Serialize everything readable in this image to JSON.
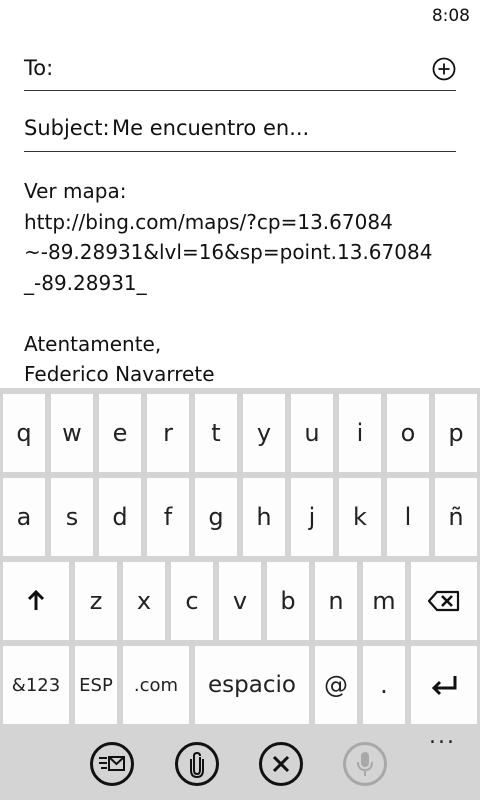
{
  "status": {
    "time": "8:08"
  },
  "compose": {
    "to_label": "To:",
    "subject_label": "Subject:",
    "subject_value": "Me encuentro en...",
    "body_lines": [
      "Ver mapa:",
      "http://bing.com/maps/?cp=13.67084",
      "~-89.28931&lvl=16&sp=point.13.67084",
      "_-89.28931_",
      "",
      "Atentamente,",
      "Federico Navarrete"
    ]
  },
  "keyboard": {
    "row1": [
      "q",
      "w",
      "e",
      "r",
      "t",
      "y",
      "u",
      "i",
      "o",
      "p"
    ],
    "row2": [
      "a",
      "s",
      "d",
      "f",
      "g",
      "h",
      "j",
      "k",
      "l",
      "ñ"
    ],
    "row3": [
      "z",
      "x",
      "c",
      "v",
      "b",
      "n",
      "m"
    ],
    "row4": {
      "symbols": "&123",
      "language": "ESP",
      "dotcom": ".com",
      "space": "espacio",
      "at": "@",
      "period": "."
    }
  },
  "appbar": {
    "icons": [
      "send-icon",
      "attach-icon",
      "discard-icon",
      "microphone-icon"
    ],
    "more": "..."
  },
  "colors": {
    "background": "#ffffff",
    "keyboard": "#d4d4d4",
    "key": "#fdfdfd",
    "text": "#111111",
    "disabled": "#a8a8a8"
  }
}
